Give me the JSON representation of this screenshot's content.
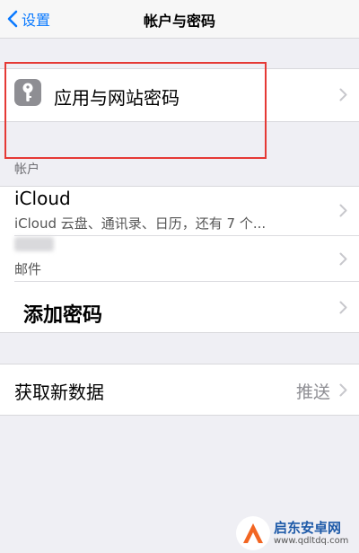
{
  "nav": {
    "back_label": "设置",
    "title": "帐户与密码"
  },
  "passwords_row": {
    "label": "应用与网站密码",
    "icon": "key-icon"
  },
  "accounts": {
    "header": "帐户",
    "items": [
      {
        "title": "iCloud",
        "subtitle": "iCloud 云盘、通讯录、日历，还有 7 个..."
      },
      {
        "title": "",
        "subtitle": "邮件"
      }
    ],
    "add_label": "添加密码"
  },
  "fetch": {
    "label": "获取新数据",
    "value": "推送"
  },
  "watermark": {
    "name": "启东安卓网",
    "url": "www.qdltdq.com"
  },
  "colors": {
    "accent": "#0a7aff",
    "annotation": "#e53935",
    "background": "#efeff4"
  }
}
